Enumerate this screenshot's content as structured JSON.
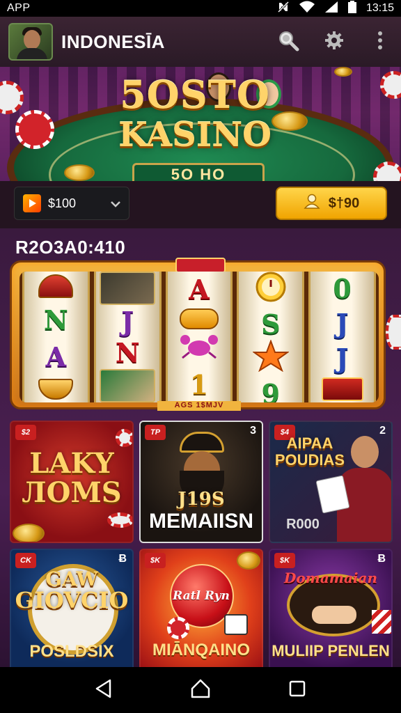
{
  "status_bar": {
    "app_label": "APP",
    "time": "13:15",
    "icons": [
      "nfc-off-icon",
      "wifi-icon",
      "signal-icon",
      "battery-icon"
    ]
  },
  "app_bar": {
    "title": "INDONESĪA",
    "actions": [
      "search-icon",
      "gear-icon",
      "more-vert-icon"
    ]
  },
  "hero": {
    "title_line1": "5OSTO",
    "title_line2": "KASINO",
    "table_sign": "5O HO"
  },
  "controls": {
    "dropdown_value": "$100",
    "bet_button_label": "$†90"
  },
  "section": {
    "title": "R2O3A0:410"
  },
  "slot": {
    "caption": "AGS 1$MJV",
    "reels": [
      {
        "symbols": [
          "bell",
          "N",
          "A",
          "bowl"
        ]
      },
      {
        "symbols": [
          "photo",
          "J",
          "N",
          "photo"
        ]
      },
      {
        "symbols": [
          "A",
          "bar",
          "crab",
          "1"
        ]
      },
      {
        "symbols": [
          "clock",
          "S",
          "star",
          "9"
        ]
      },
      {
        "symbols": [
          "0",
          "J",
          "J",
          "box"
        ]
      }
    ]
  },
  "tiles": [
    {
      "tag": "$2",
      "line1": "LAKY",
      "line2": "ЛOMS",
      "caption": "",
      "number": ""
    },
    {
      "tag": "TP",
      "line1": "J19S",
      "line2": "MEMAIISN",
      "caption": "",
      "number": "3"
    },
    {
      "tag": "$4",
      "line1": "AIPAA",
      "line2": "POUDIAS",
      "caption": "R000",
      "number": "2"
    },
    {
      "tag": "CK",
      "line1": "GAW",
      "line2": "GIOVCIO",
      "caption": "POSLDSIX",
      "number": "Ƀ"
    },
    {
      "tag": "$K",
      "line1": "Ratl Ryn",
      "line2": "",
      "caption": "MIĀNQAINO",
      "number": ""
    },
    {
      "tag": "$K",
      "line1": "Domamaian",
      "line2": "",
      "caption": "MULIIP PENLEN",
      "number": "Ƀ"
    }
  ],
  "nav_bar": {
    "buttons": [
      "back-icon",
      "home-icon",
      "recents-icon"
    ]
  },
  "colors": {
    "accent_gold": "#ffd36a",
    "felt_green": "#16693d",
    "bg_purple": "#3a1a3e"
  }
}
